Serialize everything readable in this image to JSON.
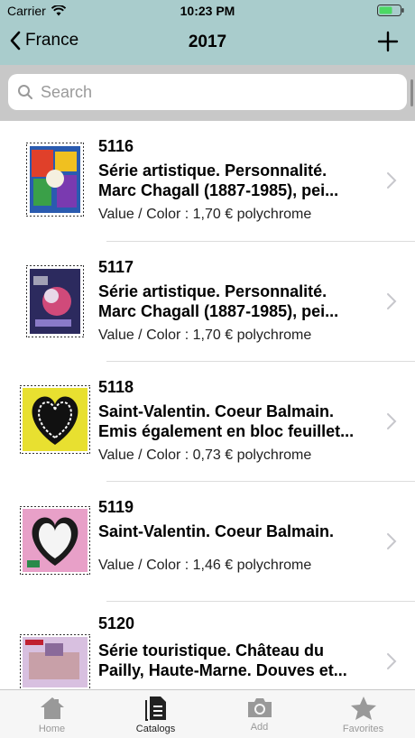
{
  "status": {
    "carrier": "Carrier",
    "time": "10:23 PM"
  },
  "nav": {
    "back_label": "France",
    "title": "2017"
  },
  "search": {
    "placeholder": "Search"
  },
  "items": [
    {
      "number": "5116",
      "line1": "Série artistique. Personnalité.",
      "line2": "Marc Chagall (1887-1985), pei...",
      "value": "Value / Color : 1,70 € polychrome"
    },
    {
      "number": "5117",
      "line1": "Série artistique. Personnalité.",
      "line2": "Marc Chagall (1887-1985), pei...",
      "value": "Value / Color : 1,70 € polychrome"
    },
    {
      "number": "5118",
      "line1": "Saint-Valentin. Coeur Balmain.",
      "line2": "Emis également en bloc feuillet...",
      "value": "Value / Color : 0,73 € polychrome"
    },
    {
      "number": "5119",
      "line1": "Saint-Valentin. Coeur Balmain.",
      "line2": "",
      "value": "Value / Color : 1,46 € polychrome"
    },
    {
      "number": "5120",
      "line1": "Série touristique. Château du",
      "line2": "Pailly, Haute-Marne. Douves et...",
      "value": ""
    }
  ],
  "tabs": {
    "home": "Home",
    "catalogs": "Catalogs",
    "add": "Add",
    "favorites": "Favorites"
  },
  "colors": {
    "nav_bg": "#a9cccc",
    "search_bg": "#c8c8c8",
    "tab_active": "#222222",
    "tab_inactive": "#999999"
  }
}
